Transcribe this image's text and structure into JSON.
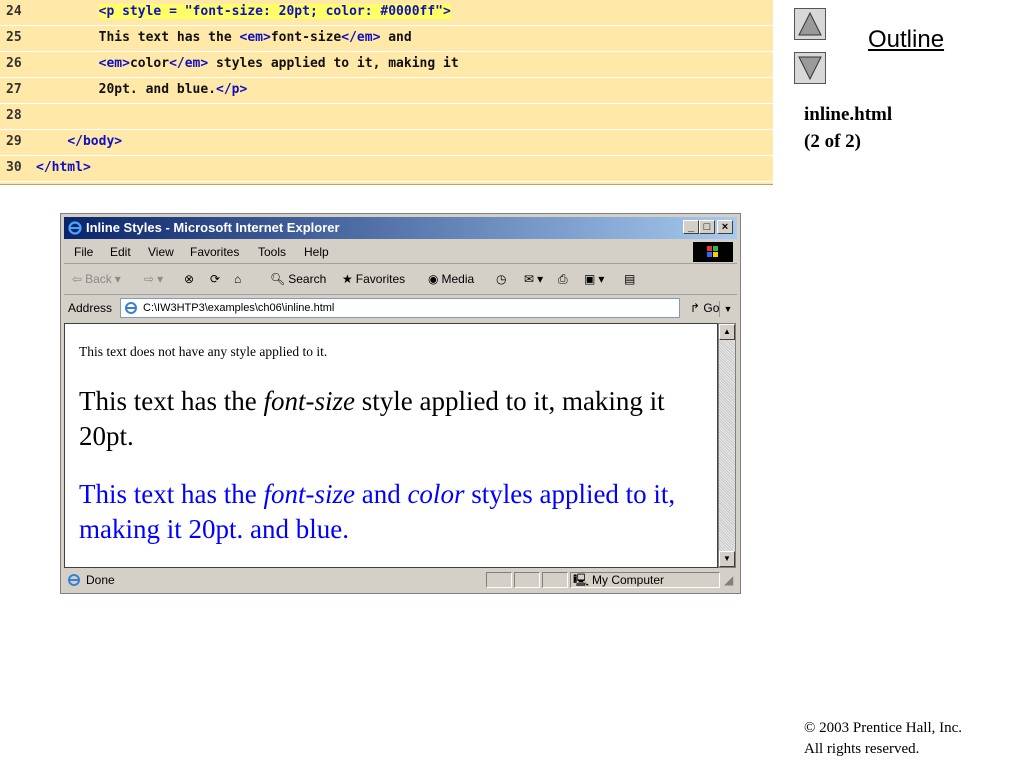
{
  "code": [
    {
      "num": "24",
      "parts": [
        {
          "t": "        ",
          "c": "txt"
        },
        {
          "t": "<p style = \"font-size: 20pt; color: #0000ff\">",
          "c": "hl"
        }
      ]
    },
    {
      "num": "25",
      "parts": [
        {
          "t": "        This text has the ",
          "c": "txt"
        },
        {
          "t": "<em>",
          "c": "tag"
        },
        {
          "t": "font-size",
          "c": "txt"
        },
        {
          "t": "</em>",
          "c": "tag"
        },
        {
          "t": " and",
          "c": "txt"
        }
      ]
    },
    {
      "num": "26",
      "parts": [
        {
          "t": "        ",
          "c": "txt"
        },
        {
          "t": "<em>",
          "c": "tag"
        },
        {
          "t": "color",
          "c": "txt"
        },
        {
          "t": "</em>",
          "c": "tag"
        },
        {
          "t": " styles applied to it, making it",
          "c": "txt"
        }
      ]
    },
    {
      "num": "27",
      "parts": [
        {
          "t": "        20pt. and blue.",
          "c": "txt"
        },
        {
          "t": "</p>",
          "c": "tag"
        }
      ]
    },
    {
      "num": "28",
      "parts": []
    },
    {
      "num": "29",
      "parts": [
        {
          "t": "    ",
          "c": "txt"
        },
        {
          "t": "</body>",
          "c": "tag"
        }
      ]
    },
    {
      "num": "30",
      "parts": [
        {
          "t": "</html>",
          "c": "tag"
        }
      ]
    }
  ],
  "outline_label": "Outline",
  "file_info": {
    "name": "inline.html",
    "page": "(2 of 2)"
  },
  "copyright": {
    "line1": "© 2003 Prentice Hall, Inc.",
    "line2": "All rights reserved."
  },
  "ie": {
    "title": "Inline Styles - Microsoft Internet Explorer",
    "menu": [
      "File",
      "Edit",
      "View",
      "Favorites",
      "Tools",
      "Help"
    ],
    "toolbar": {
      "back": "Back",
      "search": "Search",
      "favorites": "Favorites",
      "media": "Media"
    },
    "address_label": "Address",
    "address_value": "C:\\IW3HTP3\\examples\\ch06\\inline.html",
    "go_label": "Go",
    "content": {
      "p1": "This text does not have any style applied to it.",
      "p2_before": "This text has the ",
      "p2_em": "font-size",
      "p2_after": " style applied to it, making it 20pt.",
      "p3_before": "This text has the ",
      "p3_em1": "font-size",
      "p3_mid": " and ",
      "p3_em2": "color",
      "p3_after": " styles applied to it, making it 20pt. and blue."
    },
    "status": "Done",
    "zone": "My Computer"
  }
}
